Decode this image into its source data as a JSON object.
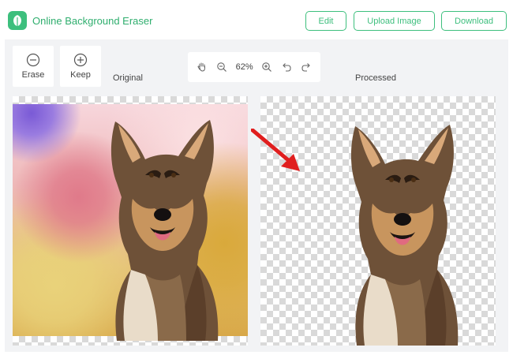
{
  "app": {
    "title": "Online Background Eraser"
  },
  "header": {
    "edit_label": "Edit",
    "upload_label": "Upload Image",
    "download_label": "Download"
  },
  "tools": {
    "erase_label": "Erase",
    "keep_label": "Keep"
  },
  "zoombar": {
    "zoom_level": "62%",
    "icons": [
      "hand-icon",
      "zoom-out-icon",
      "zoom-in-icon",
      "undo-icon",
      "redo-icon"
    ]
  },
  "panels": {
    "original_label": "Original",
    "processed_label": "Processed"
  },
  "colors": {
    "accent": "#3dbf7d",
    "workspace_bg": "#f2f3f5",
    "arrow": "#e01e1e"
  }
}
